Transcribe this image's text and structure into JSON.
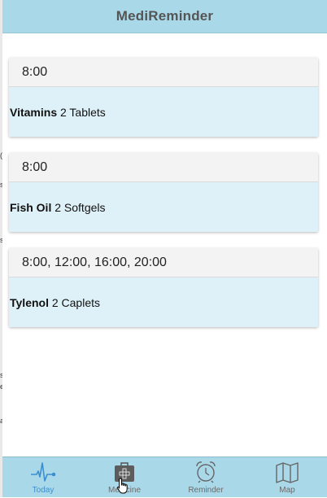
{
  "app": {
    "title": "MediReminder"
  },
  "reminders": [
    {
      "time": "8:00",
      "name": "Vitamins",
      "dose": "2 Tablets"
    },
    {
      "time": "8:00",
      "name": "Fish Oil",
      "dose": "2 Softgels"
    },
    {
      "time": "8:00, 12:00, 16:00, 20:00",
      "name": "Tylenol",
      "dose": "2 Caplets"
    }
  ],
  "tabbar": {
    "items": [
      {
        "label": "Today",
        "icon": "pulse-icon",
        "active": true
      },
      {
        "label": "Medicine",
        "icon": "medkit-icon",
        "active": false
      },
      {
        "label": "Reminder",
        "icon": "alarm-clock-icon",
        "active": false
      },
      {
        "label": "Map",
        "icon": "map-icon",
        "active": false
      }
    ]
  },
  "colors": {
    "bar": "#a9d8e9",
    "card_body": "#dff1f8",
    "card_head": "#f3f3f3",
    "active_tab": "#3a8fd0",
    "inactive_tab": "#6b6b6b"
  }
}
